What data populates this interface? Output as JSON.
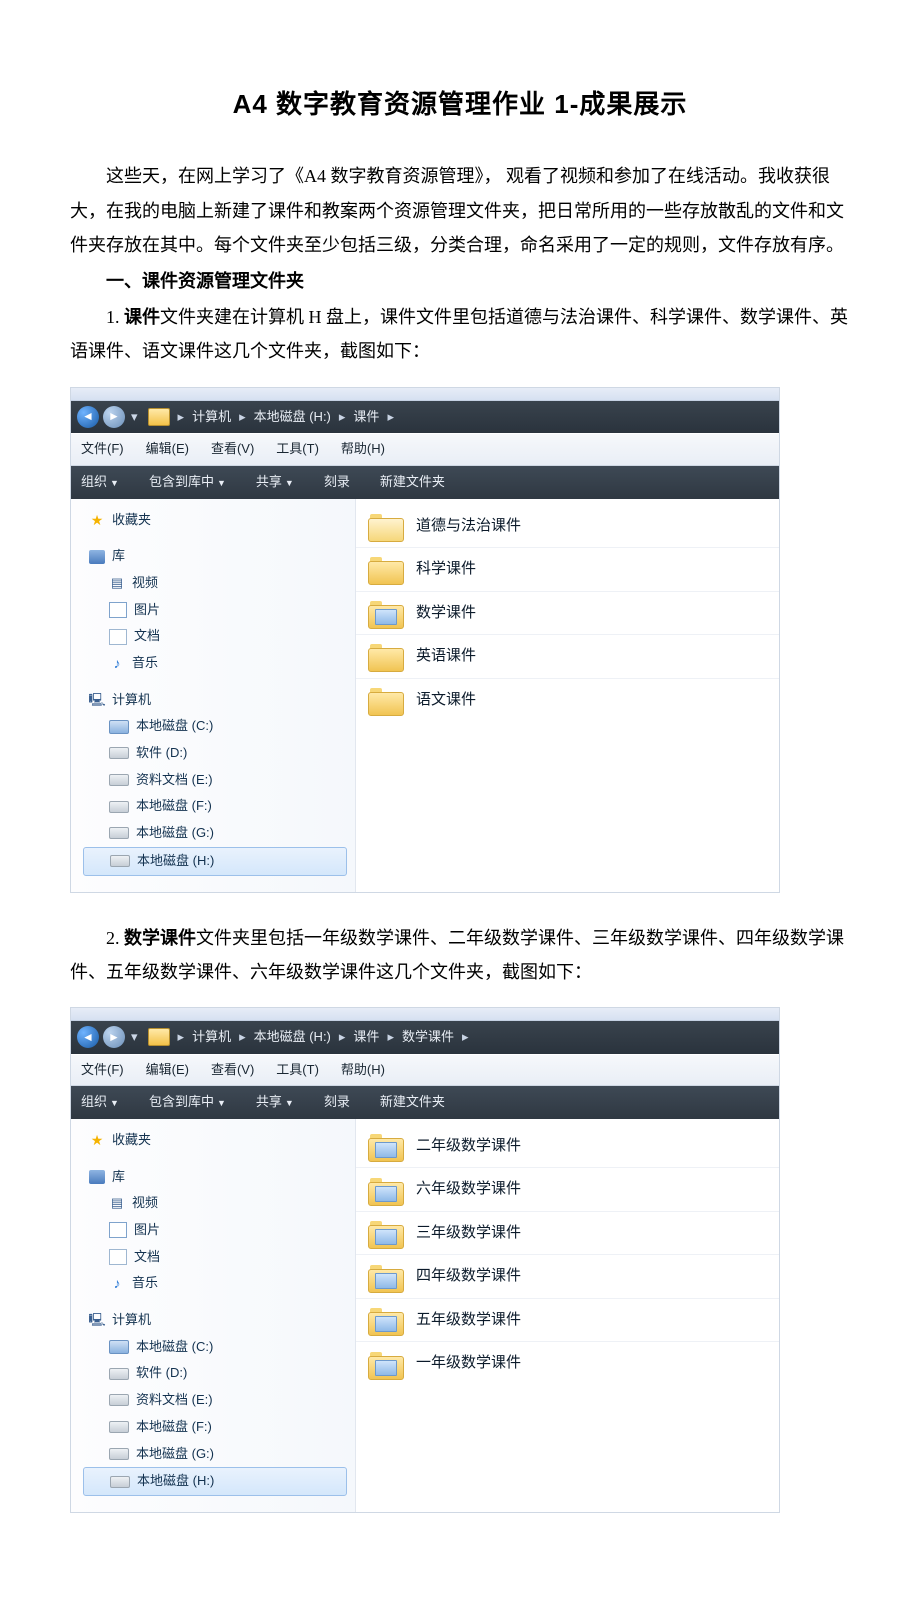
{
  "title": "A4 数字教育资源管理作业 1-成果展示",
  "intro": "这些天，在网上学习了《A4 数字教育资源管理》， 观看了视频和参加了在线活动。我收获很大，在我的电脑上新建了课件和教案两个资源管理文件夹，把日常所用的一些存放散乱的文件和文件夹存放在其中。每个文件夹至少包括三级，分类合理，命名采用了一定的规则，文件存放有序。",
  "section1_heading": "一、课件资源管理文件夹",
  "item1_lead": "1. ",
  "item1_bold": "课件",
  "item1_rest": "文件夹建在计算机 H 盘上，课件文件里包括道德与法治课件、科学课件、数学课件、英语课件、语文课件这几个文件夹，截图如下：",
  "item2_lead": "2. ",
  "item2_bold": "数学课件",
  "item2_rest": "文件夹里包括一年级数学课件、二年级数学课件、三年级数学课件、四年级数学课件、五年级数学课件、六年级数学课件这几个文件夹，截图如下：",
  "explorer_common": {
    "menus": {
      "file": "文件(F)",
      "edit": "编辑(E)",
      "view": "查看(V)",
      "tools": "工具(T)",
      "help": "帮助(H)"
    },
    "toolbar": {
      "organize": "组织",
      "include": "包含到库中",
      "share": "共享",
      "burn": "刻录",
      "newfolder": "新建文件夹"
    },
    "nav": {
      "favorites": "收藏夹",
      "libraries": "库",
      "videos": "视频",
      "pictures": "图片",
      "documents": "文档",
      "music": "音乐",
      "computer": "计算机",
      "drive_c": "本地磁盘 (C:)",
      "drive_d": "软件 (D:)",
      "drive_e": "资料文档 (E:)",
      "drive_f": "本地磁盘 (F:)",
      "drive_g": "本地磁盘 (G:)",
      "drive_h": "本地磁盘 (H:)"
    }
  },
  "explorer1": {
    "crumbs": {
      "computer": "计算机",
      "drive": "本地磁盘 (H:)",
      "folder": "课件"
    },
    "folders": [
      {
        "name": "道德与法治课件"
      },
      {
        "name": "科学课件"
      },
      {
        "name": "数学课件"
      },
      {
        "name": "英语课件"
      },
      {
        "name": "语文课件"
      }
    ]
  },
  "explorer2": {
    "crumbs": {
      "computer": "计算机",
      "drive": "本地磁盘 (H:)",
      "folder1": "课件",
      "folder2": "数学课件"
    },
    "folders": [
      {
        "name": "二年级数学课件"
      },
      {
        "name": "六年级数学课件"
      },
      {
        "name": "三年级数学课件"
      },
      {
        "name": "四年级数学课件"
      },
      {
        "name": "五年级数学课件"
      },
      {
        "name": "一年级数学课件"
      }
    ]
  }
}
